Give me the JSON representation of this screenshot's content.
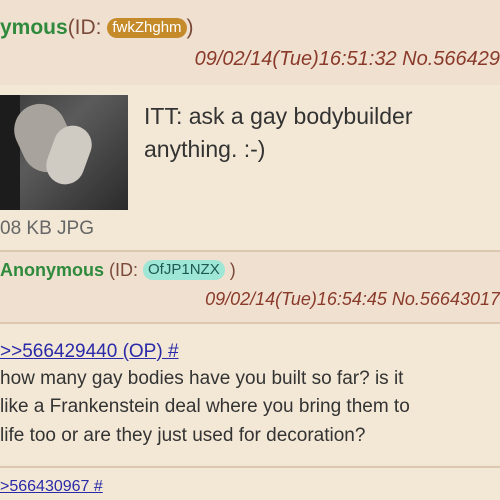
{
  "post1": {
    "name": "ymous",
    "id_prefix": "(ID: ",
    "id_value": "fwkZhghm",
    "id_suffix": ")",
    "meta": "09/02/14(Tue)16:51:32 No.566429",
    "body_line1": "ITT: ask a gay bodybuilder",
    "body_line2": "anything. :-)",
    "file_info": "08 KB JPG",
    "id_badge_color": "#c58a2a"
  },
  "post2": {
    "name": "Anonymous",
    "id_prefix": " (ID: ",
    "id_value": "OfJP1NZX",
    "id_suffix": " )",
    "meta": "09/02/14(Tue)16:54:45 No.56643017",
    "quote": ">>566429440 (OP) #",
    "body_line1": "how many gay bodies have you built so far? is it",
    "body_line2": "like a Frankenstein deal where you bring them to",
    "body_line3": "life too or are they just used for decoration?",
    "id_badge_color": "#9ee6d6"
  },
  "post3": {
    "quote": ">566430967 #"
  }
}
